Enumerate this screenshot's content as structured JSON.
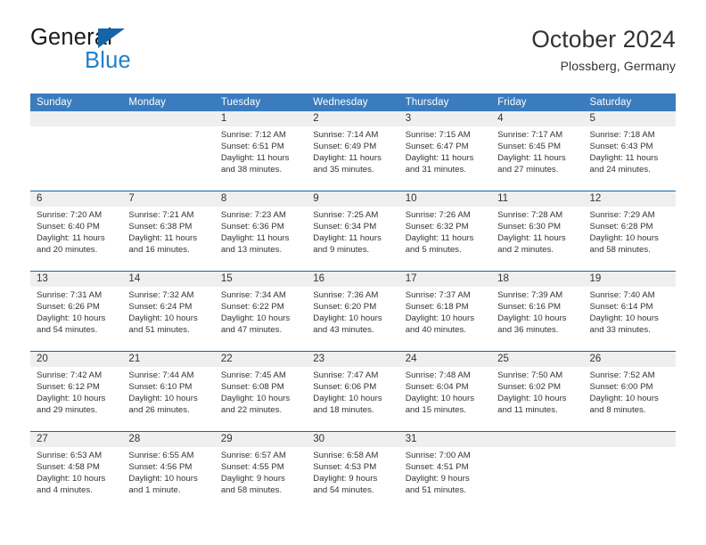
{
  "brand": {
    "name_top": "General",
    "name_bottom": "Blue",
    "triangle_icon": "brand-triangle-icon"
  },
  "header": {
    "title": "October 2024",
    "subtitle": "Plossberg, Germany"
  },
  "colors": {
    "header_blue": "#3a7cbe",
    "rule_blue": "#1565a8",
    "date_band": "#efefef",
    "brand_blue": "#2080c8",
    "text": "#333333"
  },
  "weekdays": [
    "Sunday",
    "Monday",
    "Tuesday",
    "Wednesday",
    "Thursday",
    "Friday",
    "Saturday"
  ],
  "calendar": {
    "weeks": [
      {
        "days": [
          {
            "num": "",
            "lines": []
          },
          {
            "num": "",
            "lines": []
          },
          {
            "num": "1",
            "lines": [
              "Sunrise: 7:12 AM",
              "Sunset: 6:51 PM",
              "Daylight: 11 hours",
              "and 38 minutes."
            ]
          },
          {
            "num": "2",
            "lines": [
              "Sunrise: 7:14 AM",
              "Sunset: 6:49 PM",
              "Daylight: 11 hours",
              "and 35 minutes."
            ]
          },
          {
            "num": "3",
            "lines": [
              "Sunrise: 7:15 AM",
              "Sunset: 6:47 PM",
              "Daylight: 11 hours",
              "and 31 minutes."
            ]
          },
          {
            "num": "4",
            "lines": [
              "Sunrise: 7:17 AM",
              "Sunset: 6:45 PM",
              "Daylight: 11 hours",
              "and 27 minutes."
            ]
          },
          {
            "num": "5",
            "lines": [
              "Sunrise: 7:18 AM",
              "Sunset: 6:43 PM",
              "Daylight: 11 hours",
              "and 24 minutes."
            ]
          }
        ]
      },
      {
        "days": [
          {
            "num": "6",
            "lines": [
              "Sunrise: 7:20 AM",
              "Sunset: 6:40 PM",
              "Daylight: 11 hours",
              "and 20 minutes."
            ]
          },
          {
            "num": "7",
            "lines": [
              "Sunrise: 7:21 AM",
              "Sunset: 6:38 PM",
              "Daylight: 11 hours",
              "and 16 minutes."
            ]
          },
          {
            "num": "8",
            "lines": [
              "Sunrise: 7:23 AM",
              "Sunset: 6:36 PM",
              "Daylight: 11 hours",
              "and 13 minutes."
            ]
          },
          {
            "num": "9",
            "lines": [
              "Sunrise: 7:25 AM",
              "Sunset: 6:34 PM",
              "Daylight: 11 hours",
              "and 9 minutes."
            ]
          },
          {
            "num": "10",
            "lines": [
              "Sunrise: 7:26 AM",
              "Sunset: 6:32 PM",
              "Daylight: 11 hours",
              "and 5 minutes."
            ]
          },
          {
            "num": "11",
            "lines": [
              "Sunrise: 7:28 AM",
              "Sunset: 6:30 PM",
              "Daylight: 11 hours",
              "and 2 minutes."
            ]
          },
          {
            "num": "12",
            "lines": [
              "Sunrise: 7:29 AM",
              "Sunset: 6:28 PM",
              "Daylight: 10 hours",
              "and 58 minutes."
            ]
          }
        ]
      },
      {
        "days": [
          {
            "num": "13",
            "lines": [
              "Sunrise: 7:31 AM",
              "Sunset: 6:26 PM",
              "Daylight: 10 hours",
              "and 54 minutes."
            ]
          },
          {
            "num": "14",
            "lines": [
              "Sunrise: 7:32 AM",
              "Sunset: 6:24 PM",
              "Daylight: 10 hours",
              "and 51 minutes."
            ]
          },
          {
            "num": "15",
            "lines": [
              "Sunrise: 7:34 AM",
              "Sunset: 6:22 PM",
              "Daylight: 10 hours",
              "and 47 minutes."
            ]
          },
          {
            "num": "16",
            "lines": [
              "Sunrise: 7:36 AM",
              "Sunset: 6:20 PM",
              "Daylight: 10 hours",
              "and 43 minutes."
            ]
          },
          {
            "num": "17",
            "lines": [
              "Sunrise: 7:37 AM",
              "Sunset: 6:18 PM",
              "Daylight: 10 hours",
              "and 40 minutes."
            ]
          },
          {
            "num": "18",
            "lines": [
              "Sunrise: 7:39 AM",
              "Sunset: 6:16 PM",
              "Daylight: 10 hours",
              "and 36 minutes."
            ]
          },
          {
            "num": "19",
            "lines": [
              "Sunrise: 7:40 AM",
              "Sunset: 6:14 PM",
              "Daylight: 10 hours",
              "and 33 minutes."
            ]
          }
        ]
      },
      {
        "days": [
          {
            "num": "20",
            "lines": [
              "Sunrise: 7:42 AM",
              "Sunset: 6:12 PM",
              "Daylight: 10 hours",
              "and 29 minutes."
            ]
          },
          {
            "num": "21",
            "lines": [
              "Sunrise: 7:44 AM",
              "Sunset: 6:10 PM",
              "Daylight: 10 hours",
              "and 26 minutes."
            ]
          },
          {
            "num": "22",
            "lines": [
              "Sunrise: 7:45 AM",
              "Sunset: 6:08 PM",
              "Daylight: 10 hours",
              "and 22 minutes."
            ]
          },
          {
            "num": "23",
            "lines": [
              "Sunrise: 7:47 AM",
              "Sunset: 6:06 PM",
              "Daylight: 10 hours",
              "and 18 minutes."
            ]
          },
          {
            "num": "24",
            "lines": [
              "Sunrise: 7:48 AM",
              "Sunset: 6:04 PM",
              "Daylight: 10 hours",
              "and 15 minutes."
            ]
          },
          {
            "num": "25",
            "lines": [
              "Sunrise: 7:50 AM",
              "Sunset: 6:02 PM",
              "Daylight: 10 hours",
              "and 11 minutes."
            ]
          },
          {
            "num": "26",
            "lines": [
              "Sunrise: 7:52 AM",
              "Sunset: 6:00 PM",
              "Daylight: 10 hours",
              "and 8 minutes."
            ]
          }
        ]
      },
      {
        "days": [
          {
            "num": "27",
            "lines": [
              "Sunrise: 6:53 AM",
              "Sunset: 4:58 PM",
              "Daylight: 10 hours",
              "and 4 minutes."
            ]
          },
          {
            "num": "28",
            "lines": [
              "Sunrise: 6:55 AM",
              "Sunset: 4:56 PM",
              "Daylight: 10 hours",
              "and 1 minute."
            ]
          },
          {
            "num": "29",
            "lines": [
              "Sunrise: 6:57 AM",
              "Sunset: 4:55 PM",
              "Daylight: 9 hours",
              "and 58 minutes."
            ]
          },
          {
            "num": "30",
            "lines": [
              "Sunrise: 6:58 AM",
              "Sunset: 4:53 PM",
              "Daylight: 9 hours",
              "and 54 minutes."
            ]
          },
          {
            "num": "31",
            "lines": [
              "Sunrise: 7:00 AM",
              "Sunset: 4:51 PM",
              "Daylight: 9 hours",
              "and 51 minutes."
            ]
          },
          {
            "num": "",
            "lines": []
          },
          {
            "num": "",
            "lines": []
          }
        ]
      }
    ]
  }
}
